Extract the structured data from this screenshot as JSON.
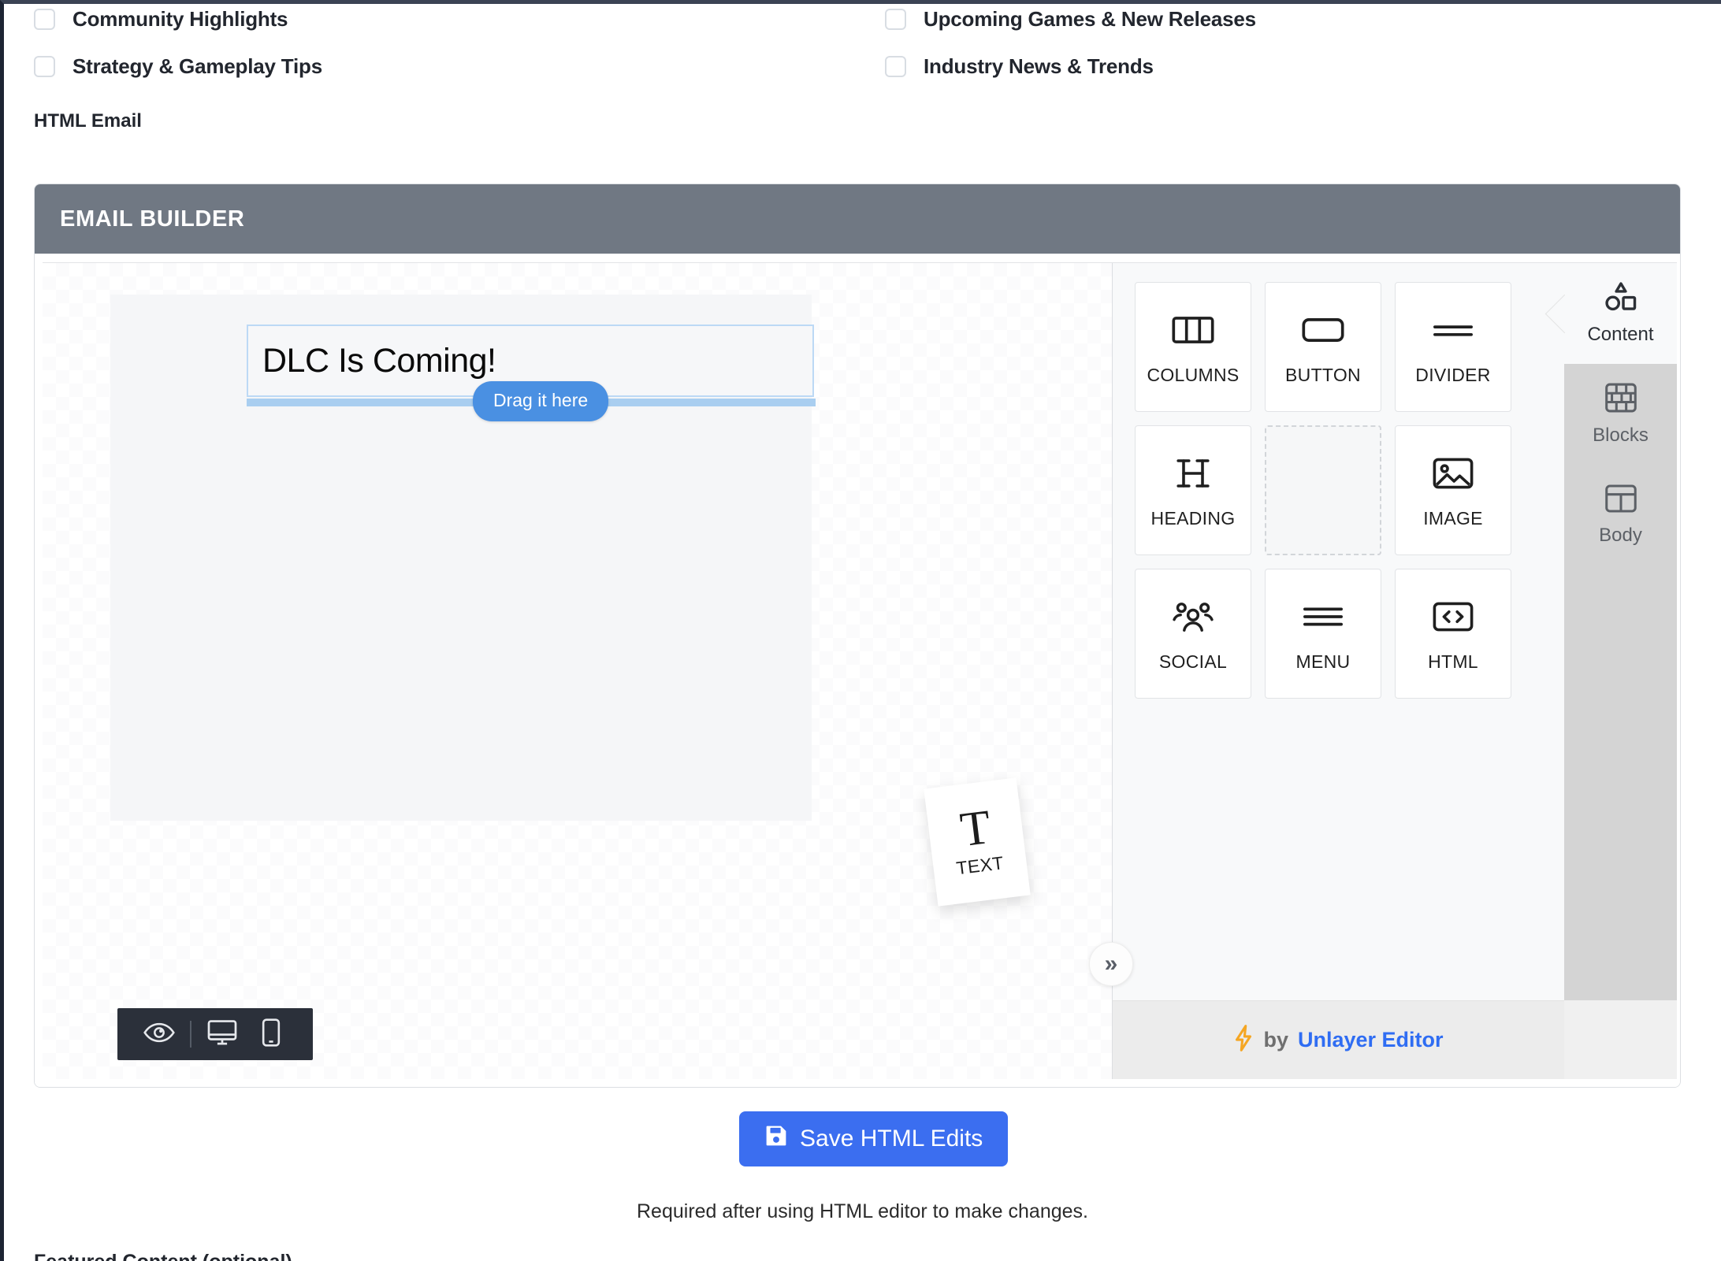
{
  "checkboxes": [
    {
      "label": "Community Highlights",
      "checked": false
    },
    {
      "label": "Upcoming Games & New Releases",
      "checked": false
    },
    {
      "label": "Strategy & Gameplay Tips",
      "checked": false
    },
    {
      "label": "Industry News & Trends",
      "checked": false
    }
  ],
  "section": {
    "html_email_label": "HTML Email"
  },
  "builder": {
    "header_title": "EMAIL BUILDER",
    "canvas": {
      "heading_block_text": "DLC Is Coming!",
      "drag_pill_label": "Drag it here",
      "drag_ghost": {
        "glyph": "T",
        "label": "TEXT"
      }
    },
    "preview_bar": {
      "eye_icon": "eye-icon",
      "desktop_icon": "desktop-icon",
      "mobile_icon": "mobile-icon"
    },
    "collapse_button": {
      "icon": "chevron-double-right-icon",
      "glyph": "»"
    },
    "tools": [
      {
        "label": "COLUMNS",
        "icon": "columns-icon",
        "empty": false
      },
      {
        "label": "BUTTON",
        "icon": "button-icon",
        "empty": false
      },
      {
        "label": "DIVIDER",
        "icon": "divider-icon",
        "empty": false
      },
      {
        "label": "HEADING",
        "icon": "heading-icon",
        "empty": false
      },
      {
        "label": "",
        "icon": "empty-slot-icon",
        "empty": true
      },
      {
        "label": "IMAGE",
        "icon": "image-icon",
        "empty": false
      },
      {
        "label": "SOCIAL",
        "icon": "social-icon",
        "empty": false
      },
      {
        "label": "MENU",
        "icon": "menu-icon",
        "empty": false
      },
      {
        "label": "HTML",
        "icon": "html-code-icon",
        "empty": false
      }
    ],
    "footer": {
      "bolt_icon": "lightning-bolt-icon",
      "bolt_glyph": "⚡",
      "by_text": "by",
      "brand": "Unlayer Editor"
    },
    "side_tabs": [
      {
        "label": "Content",
        "icon": "shapes-icon",
        "active": true
      },
      {
        "label": "Blocks",
        "icon": "bricks-icon",
        "active": false
      },
      {
        "label": "Body",
        "icon": "layout-icon",
        "active": false
      }
    ]
  },
  "save": {
    "button_label": "Save HTML Edits",
    "button_icon": "save-floppy-icon",
    "note": "Required after using HTML editor to make changes."
  },
  "bottom": {
    "cut_off_heading": "Featured Content (optional)"
  },
  "colors": {
    "header_gray": "#707883",
    "accent_blue": "#3b6ef0",
    "drag_blue": "#4a90e2",
    "brand_blue": "#2f6df3",
    "bolt_orange": "#f5a623",
    "panel_bg": "#f8f9fa",
    "tab_bg": "#d4d4d4",
    "toolbar_dark": "#2b303a"
  }
}
